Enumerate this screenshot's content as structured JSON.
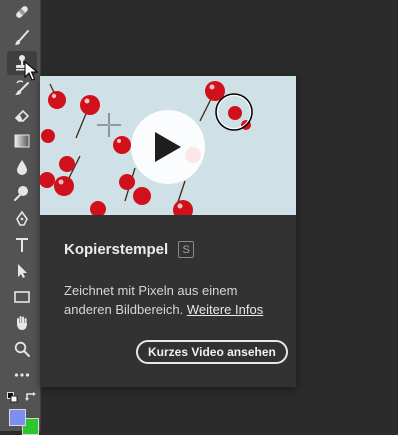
{
  "tooltip": {
    "title": "Kopierstempel",
    "shortcut": "S",
    "description": "Zeichnet mit Pixeln aus einem anderen Bildbereich. ",
    "link_label": "Weitere Infos",
    "video_button_label": "Kurzes Video ansehen"
  },
  "toolbar": {
    "active_tool": "clone-stamp",
    "tools": [
      "healing-brush",
      "brush",
      "clone-stamp",
      "history-brush",
      "eraser",
      "gradient",
      "blur",
      "dodge",
      "pen",
      "type",
      "path-selection",
      "rectangle",
      "hand",
      "zoom",
      "more"
    ],
    "foreground_color": "#7b8ff0",
    "background_color": "#2ec62e"
  },
  "colors": {
    "toolbar_bg": "#535353",
    "card_bg": "#323232",
    "image_bg": "#cfe0e7",
    "cherry": "#d0101a"
  }
}
